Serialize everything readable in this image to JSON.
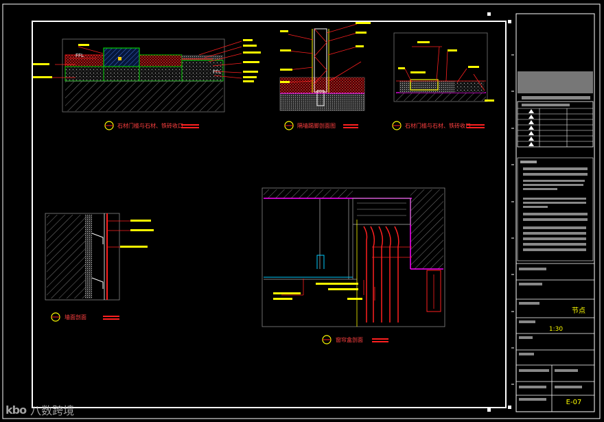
{
  "title_block": {
    "drawing_title": "节点",
    "scale": "1:30",
    "sheet_number": "E-07"
  },
  "details": [
    {
      "id": "d1",
      "title": "石材门槛与石材、铁砖收口"
    },
    {
      "id": "d2",
      "title": "隔墙踢脚剖面图"
    },
    {
      "id": "d3",
      "title": "石材门槛与石材、铁砖收口"
    },
    {
      "id": "d4",
      "title": "墙面剖面"
    },
    {
      "id": "d5",
      "title": "窗帘盒剖面"
    }
  ],
  "annotations": {
    "ffl": "FFL"
  },
  "colors": {
    "frame": "#ffffff",
    "line_red": "#ff2020",
    "text_yellow": "#ffff00",
    "magenta": "#ff00ff",
    "green": "#00cc00",
    "cyan": "#00ffff",
    "gray": "#8c8c8c"
  },
  "watermark": {
    "logo": "kbo",
    "text": "八数跨境"
  }
}
